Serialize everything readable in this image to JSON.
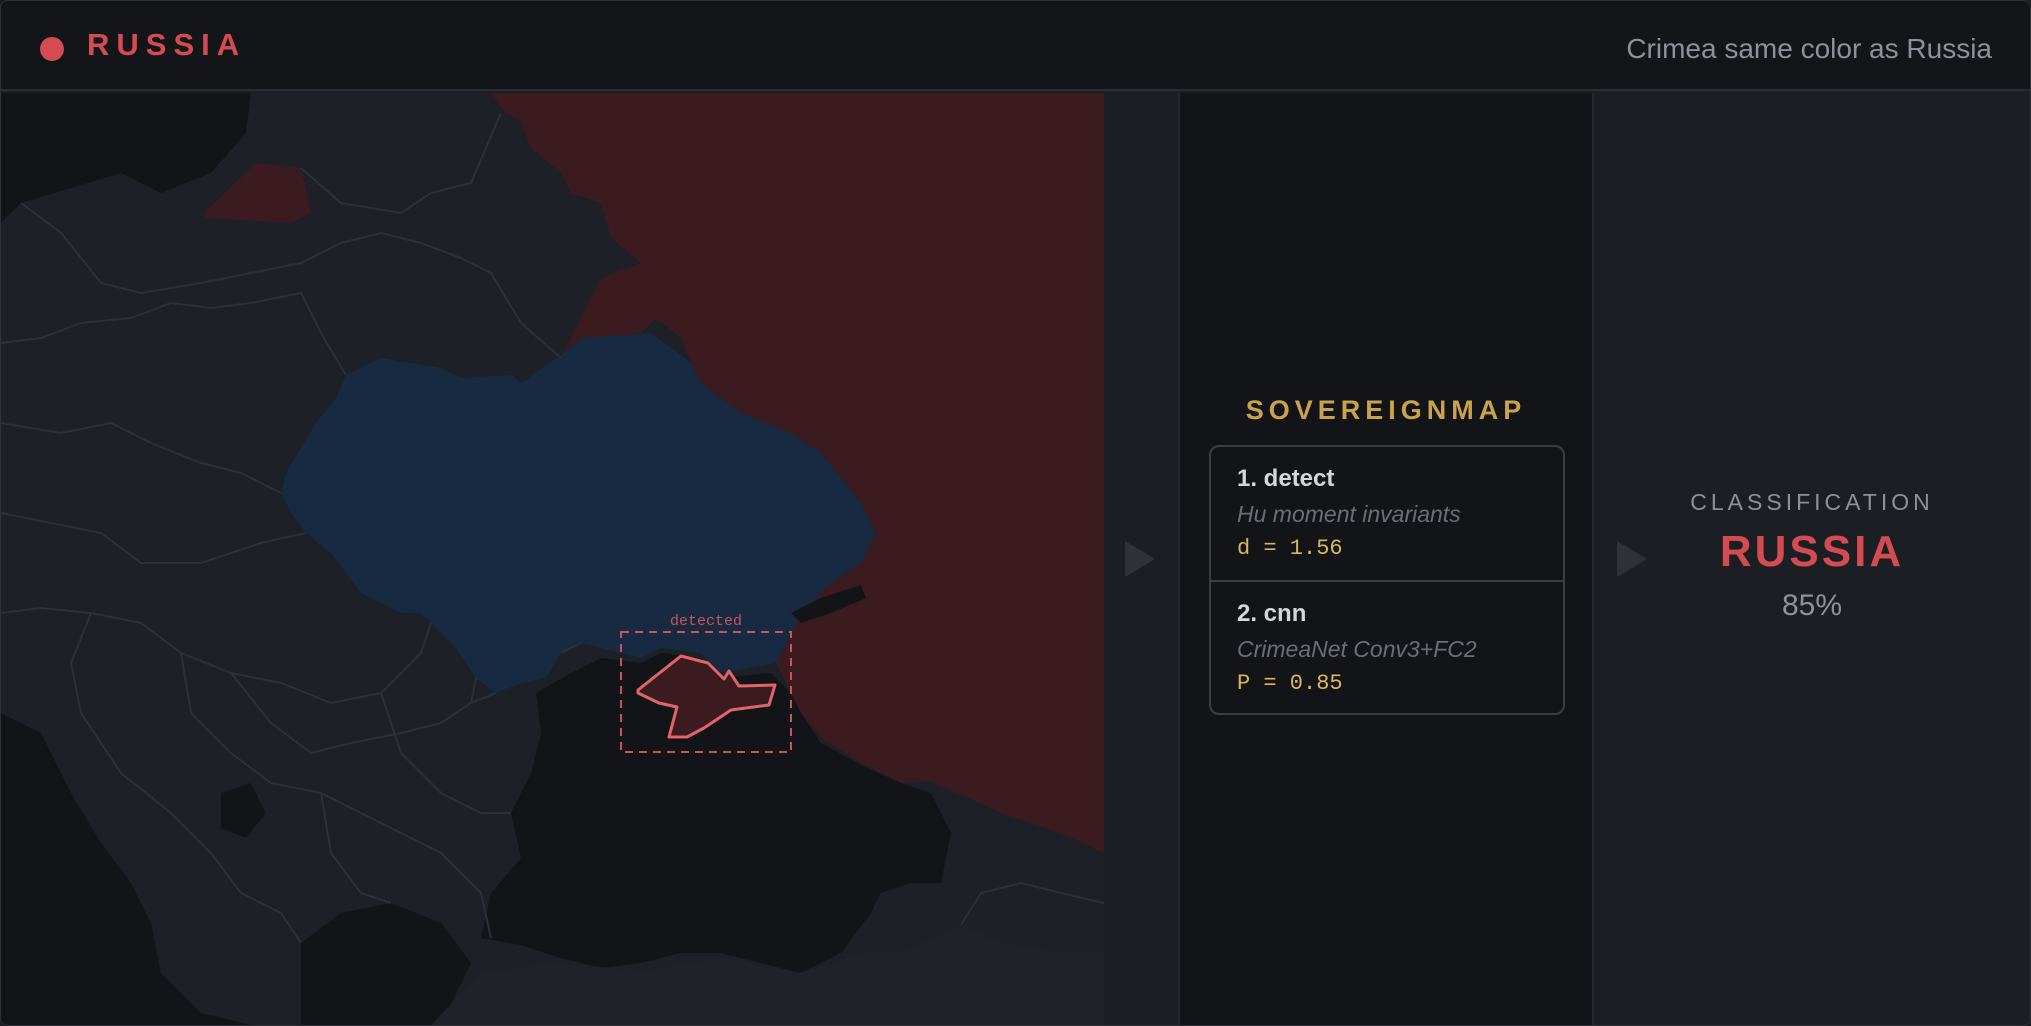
{
  "header": {
    "country": "RUSSIA",
    "caption": "Crimea same color as Russia",
    "accent_color": "#d44b52"
  },
  "map": {
    "detection_label": "detected",
    "russia_color": "#3b1b1f",
    "ukraine_color": "#172a42"
  },
  "pipeline": {
    "title": "SOVEREIGNMAP",
    "steps": [
      {
        "title": "1. detect",
        "method": "Hu moment invariants",
        "metric": "d = 1.56"
      },
      {
        "title": "2. cnn",
        "method": "CrimeaNet Conv3+FC2",
        "metric": "P = 0.85"
      }
    ]
  },
  "result": {
    "label": "CLASSIFICATION",
    "value": "RUSSIA",
    "confidence": "85%"
  },
  "icons": [
    "status-dot-icon",
    "arrow-right-icon"
  ]
}
